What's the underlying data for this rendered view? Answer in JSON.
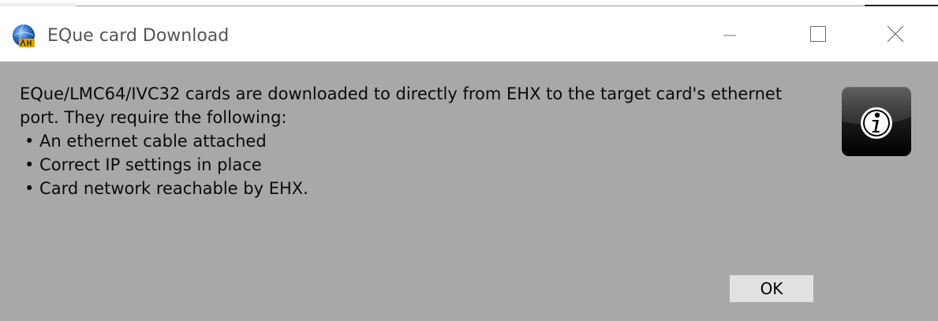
{
  "window": {
    "title": "EQue card Download",
    "app_icon": "ehx-globe-icon",
    "controls": {
      "minimize_icon": "minimize-icon",
      "maximize_icon": "maximize-icon",
      "close_icon": "close-icon"
    }
  },
  "dialog": {
    "message_line1": "EQue/LMC64/IVC32 cards are downloaded to directly from EHX to the target card's ethernet port. They require the following:",
    "requirements": [
      "• An ethernet cable attached",
      "• Correct IP settings in place",
      "• Card network reachable by EHX."
    ],
    "icon": "info-icon",
    "ok_label": "OK"
  },
  "colors": {
    "client_background": "#a8a8a8",
    "titlebar_background": "#ffffff",
    "button_face": "#e1e1e1"
  }
}
